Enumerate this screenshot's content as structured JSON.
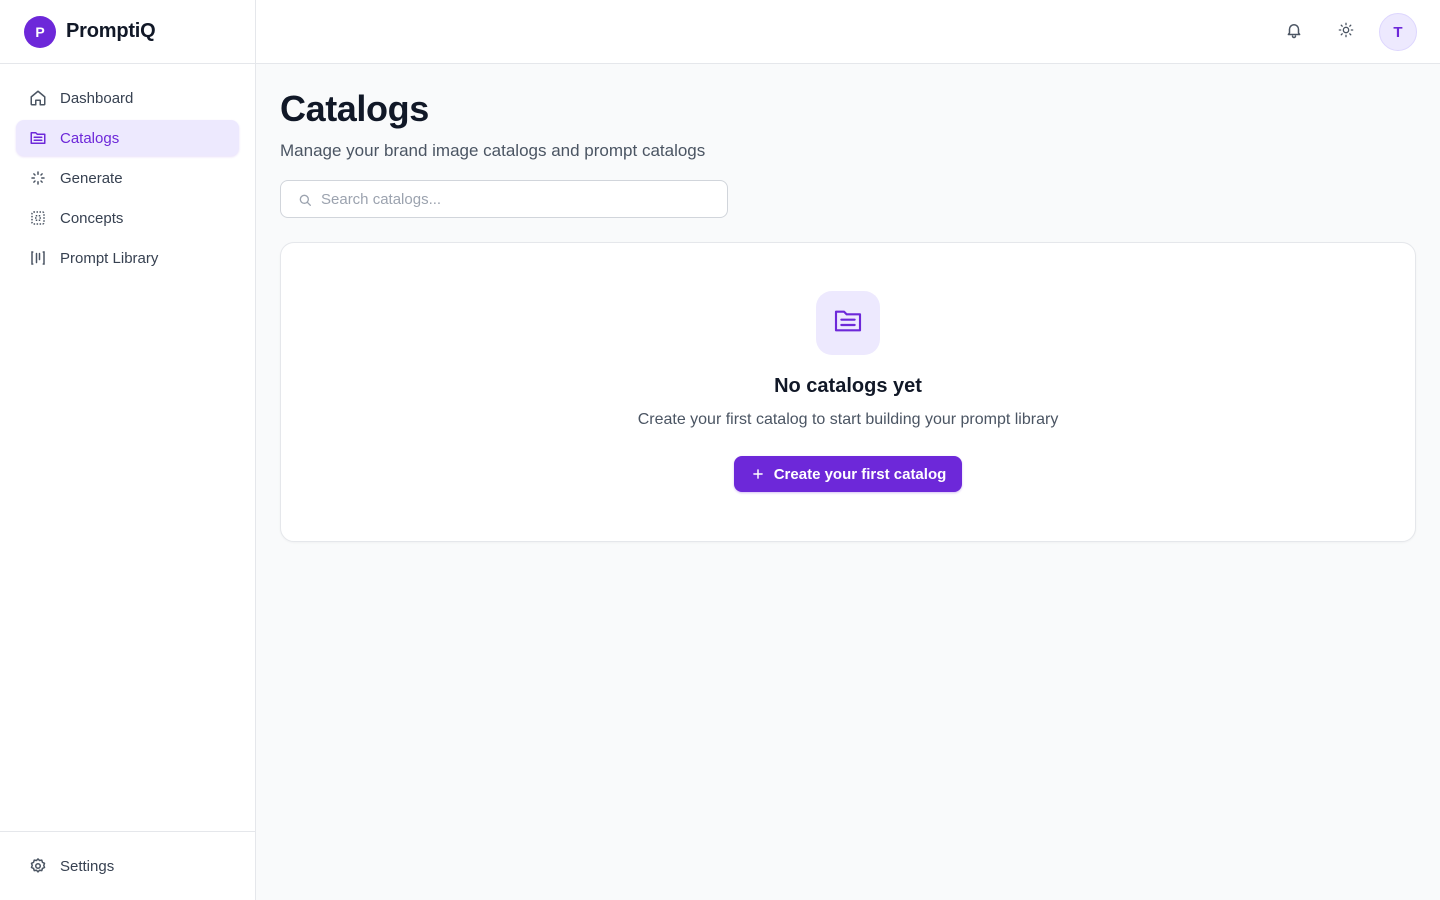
{
  "brand": {
    "logo_letter": "P",
    "name": "PromptiQ"
  },
  "sidebar": {
    "items": [
      {
        "label": "Dashboard",
        "icon": "home-icon",
        "active": false
      },
      {
        "label": "Catalogs",
        "icon": "folder-icon",
        "active": true
      },
      {
        "label": "Generate",
        "icon": "sparkles-icon",
        "active": false
      },
      {
        "label": "Concepts",
        "icon": "grid-icon",
        "active": false
      },
      {
        "label": "Prompt Library",
        "icon": "library-icon",
        "active": false
      }
    ],
    "settings": {
      "label": "Settings",
      "icon": "gear-icon"
    }
  },
  "header": {
    "notifications_icon": "bell-icon",
    "theme_icon": "sun-icon",
    "avatar_letter": "T"
  },
  "main": {
    "title": "Catalogs",
    "subtitle": "Manage your brand image catalogs and prompt catalogs",
    "search": {
      "placeholder": "Search catalogs...",
      "value": ""
    },
    "empty_state": {
      "icon": "folder-open-icon",
      "title": "No catalogs yet",
      "description": "Create your first catalog to start building your prompt library",
      "button_label": "Create your first catalog",
      "button_icon": "plus-icon"
    }
  },
  "colors": {
    "accent": "#6d28d9",
    "accent_light": "#ede9fe",
    "background": "#f9fafb",
    "border": "#e5e7eb"
  }
}
